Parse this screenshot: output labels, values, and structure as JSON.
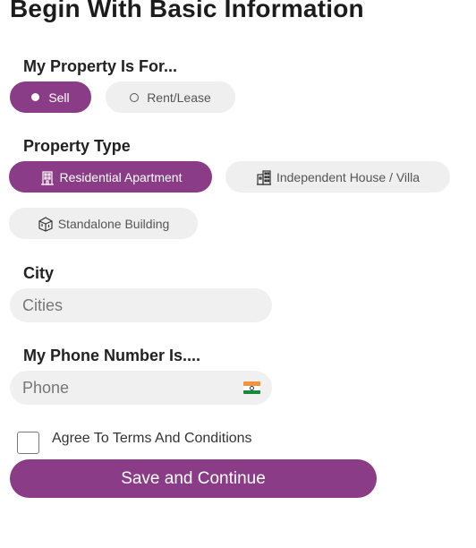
{
  "page_title": "Begin With Basic Information",
  "property_for": {
    "label": "My Property Is For...",
    "options": [
      {
        "label": "Sell",
        "selected": true
      },
      {
        "label": "Rent/Lease",
        "selected": false
      }
    ]
  },
  "property_type": {
    "label": "Property Type",
    "options": [
      {
        "label": "Residential Apartment",
        "selected": true
      },
      {
        "label": "Independent House / Villa",
        "selected": false
      },
      {
        "label": "Standalone Building",
        "selected": false
      }
    ]
  },
  "city": {
    "label": "City",
    "placeholder": "Cities",
    "value": ""
  },
  "phone": {
    "label": "My Phone Number Is....",
    "placeholder": "Phone",
    "value": "",
    "country_flag": "india-flag-icon"
  },
  "terms": {
    "label": "Agree To Terms And Conditions",
    "checked": false
  },
  "submit_label": "Save and Continue",
  "colors": {
    "accent": "#8a3c86",
    "pill_inactive": "#efefef",
    "field_bg": "#f0f0f0"
  }
}
